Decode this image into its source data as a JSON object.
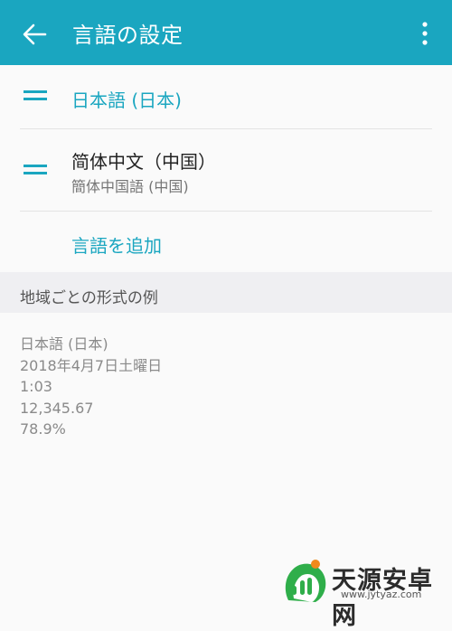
{
  "appbar": {
    "title": "言語の設定",
    "back_icon": "arrow-left-icon",
    "more_icon": "more-vert-icon",
    "color": "#1aa6c0"
  },
  "languages": [
    {
      "label": "日本語 (日本)",
      "sublabel": ""
    },
    {
      "label": "简体中文（中国）",
      "sublabel": "簡体中国語 (中国)"
    }
  ],
  "add_language_label": "言語を追加",
  "section_header": "地域ごとの形式の例",
  "examples": [
    "日本語 (日本)",
    "2018年4月7日土曜日",
    "1:03",
    "12,345.67",
    "78.9%"
  ],
  "watermark": {
    "text": "天源安卓网",
    "url": "www.jytyaz.com"
  }
}
